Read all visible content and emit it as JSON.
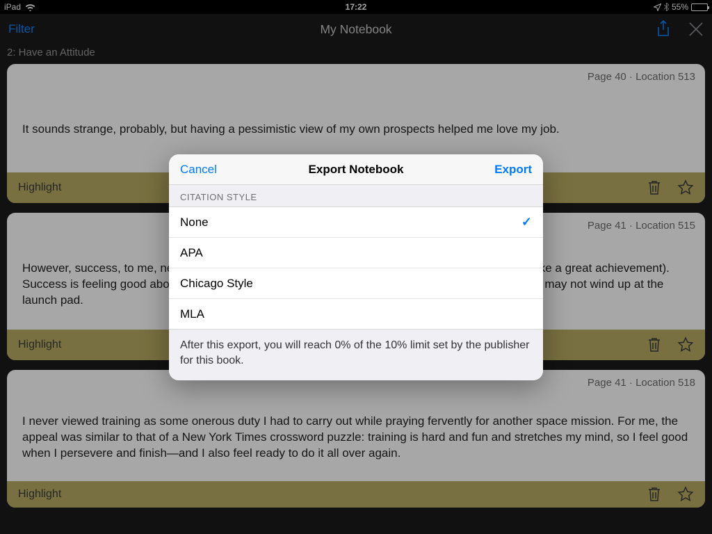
{
  "status": {
    "device": "iPad",
    "time": "17:22",
    "battery_pct": "55%"
  },
  "nav": {
    "filter": "Filter",
    "title": "My Notebook"
  },
  "subheader": "2: Have an Attitude",
  "cards": [
    {
      "meta": "Page 40 · Location 513",
      "body": "It sounds strange, probably, but having a pessimistic view of my own prospects helped me love my job.",
      "tag": "Highlight"
    },
    {
      "meta": "Page 41 · Location 515",
      "body": "However, success, to me, never was and still isn't about lifting off in a rocket (though that sure felt like a great achievement). Success is feeling good about the work you do throughout the long, unheralded journey that may or may not wind up at the launch pad.",
      "tag": "Highlight"
    },
    {
      "meta": "Page 41 · Location 518",
      "body": "I never viewed training as some onerous duty I had to carry out while praying fervently for another space mission. For me, the appeal was similar to that of a New York Times crossword puzzle: training is hard and fun and stretches my mind, so I feel good when I persevere and finish—and I also feel ready to do it all over again.",
      "tag": "Highlight"
    }
  ],
  "modal": {
    "cancel": "Cancel",
    "title": "Export Notebook",
    "export": "Export",
    "section": "CITATION STYLE",
    "options": {
      "none": "None",
      "apa": "APA",
      "chicago": "Chicago Style",
      "mla": "MLA"
    },
    "selected": "none",
    "footer": "After this export, you will reach 0% of the 10% limit set by the publisher for this book."
  }
}
